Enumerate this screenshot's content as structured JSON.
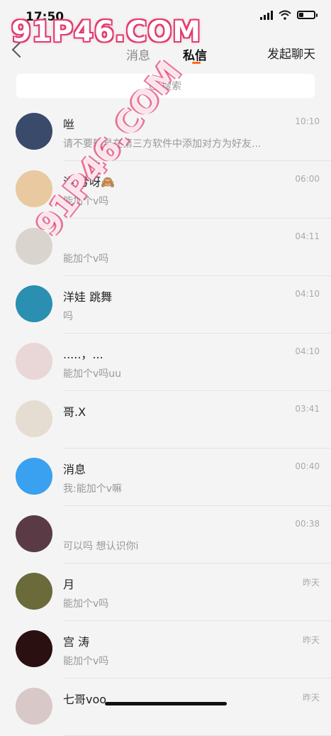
{
  "status": {
    "time": "17:50"
  },
  "watermark": {
    "main": "91P46.COM",
    "diagonal": "91P46.COM"
  },
  "nav": {
    "tab_messages": "消息",
    "tab_private": "私信",
    "start_chat": "发起聊天"
  },
  "search": {
    "placeholder": "搜索"
  },
  "conversations": [
    {
      "name": "咝",
      "preview": "请不要轻易在第三方软件中添加对方为好友...",
      "time": "10:10",
      "avatar_color": "#3a4a6b"
    },
    {
      "name": "洮              兮呀🙈",
      "preview": "能加个v吗",
      "time": "06:00",
      "avatar_color": "#e8c9a0"
    },
    {
      "name": "",
      "preview": "能加个v吗",
      "time": "04:11",
      "avatar_color": "#d9d4ce"
    },
    {
      "name": "洋娃              跳舞",
      "preview": "吗",
      "time": "04:10",
      "avatar_color": "#2a8fb0"
    },
    {
      "name": "          .....，...",
      "preview": "能加个v吗uu",
      "time": "04:10",
      "avatar_color": "#e9d6d6"
    },
    {
      "name": "          哥.X",
      "preview": "",
      "time": "03:41",
      "avatar_color": "#e5ddd2"
    },
    {
      "name": "          消息",
      "preview": "我:能加个v嘛",
      "time": "00:40",
      "avatar_color": "#3aa0f0"
    },
    {
      "name": "",
      "preview": "可以吗 想认识你i",
      "time": "00:38",
      "avatar_color": "#5a3a44"
    },
    {
      "name": "          月",
      "preview": "能加个v吗",
      "time": "昨天",
      "avatar_color": "#6a6a3a"
    },
    {
      "name": "宫          涛",
      "preview": "能加个v吗",
      "time": "昨天",
      "avatar_color": "#2a1010"
    },
    {
      "name": "七哥voo",
      "preview": "",
      "time": "昨天",
      "avatar_color": "#d8c8c8"
    }
  ]
}
